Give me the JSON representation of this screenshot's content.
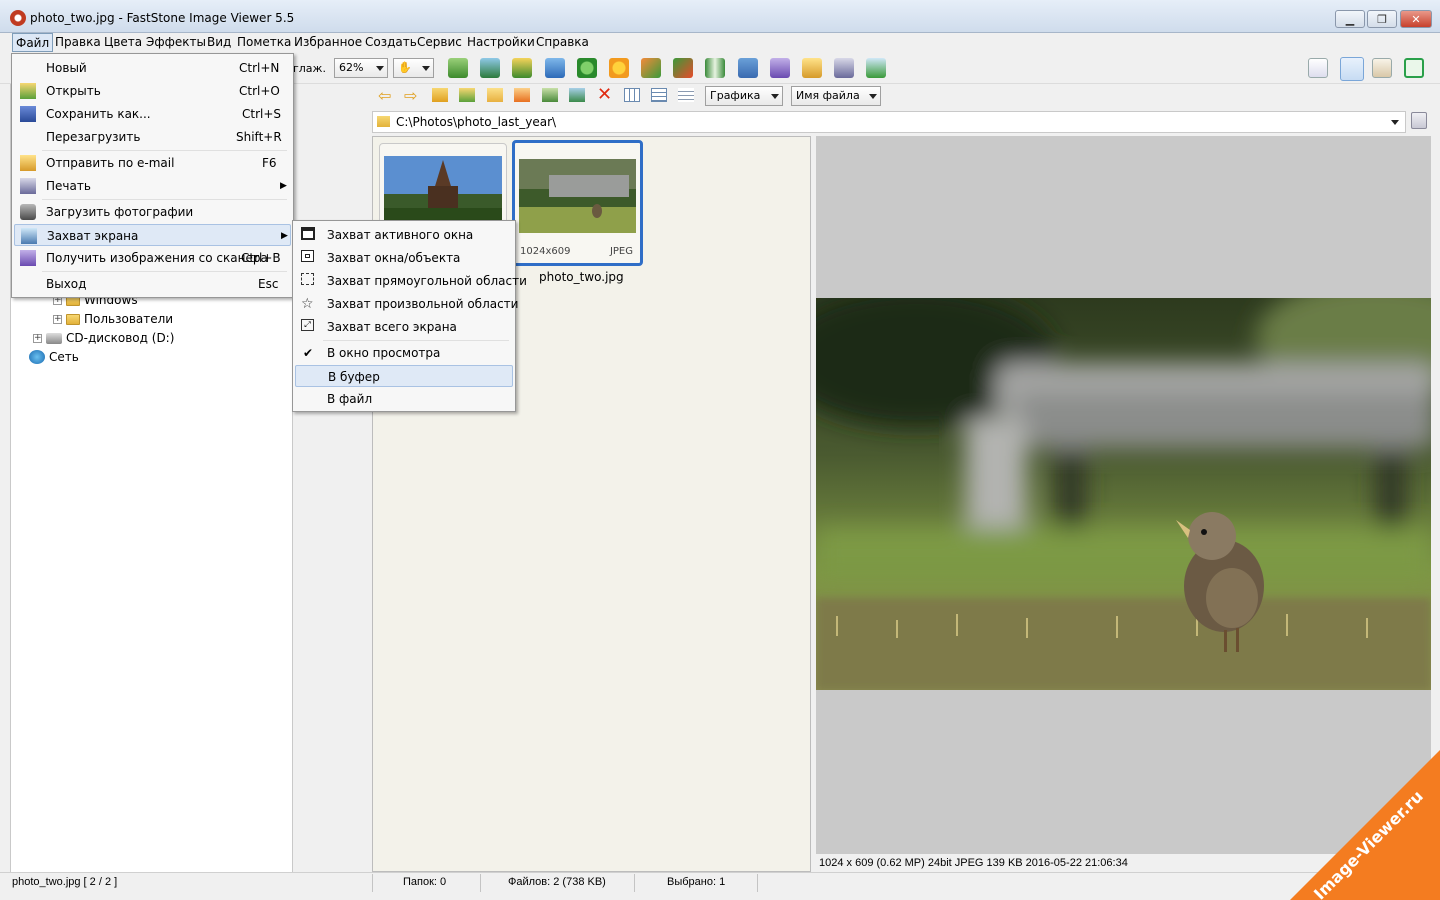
{
  "window": {
    "title": "photo_two.jpg  -  FastStone Image Viewer 5.5",
    "minimize_icon": "minimize-icon",
    "maximize_icon": "maximize-icon",
    "close_icon": "close-icon"
  },
  "menubar": [
    "Файл",
    "Правка",
    "Цвета",
    "Эффекты",
    "Вид",
    "Пометка",
    "Избранное",
    "Создать",
    "Сервис",
    "Настройки",
    "Справка"
  ],
  "toolbar": {
    "smooth_label": "глаж.",
    "zoom_value": "62%",
    "filter_value": "Графика",
    "sort_value": "Имя файла"
  },
  "path": "C:\\Photos\\photo_last_year\\",
  "tree": [
    {
      "label": "Windows"
    },
    {
      "label": "Пользователи"
    },
    {
      "label": "CD-дисковод (D:)"
    },
    {
      "label": "Сеть"
    }
  ],
  "file_menu": [
    {
      "label": "Новый",
      "shortcut": "Ctrl+N",
      "icon": ""
    },
    {
      "label": "Открыть",
      "shortcut": "Ctrl+O",
      "icon": "open-icon"
    },
    {
      "label": "Сохранить как...",
      "shortcut": "Ctrl+S",
      "icon": "save-icon"
    },
    {
      "label": "Перезагрузить",
      "shortcut": "Shift+R",
      "icon": ""
    },
    {
      "label": "Отправить по e-mail",
      "shortcut": "F6",
      "icon": "email-icon"
    },
    {
      "label": "Печать",
      "shortcut": "",
      "icon": "print-icon"
    },
    {
      "label": "Загрузить фотографии",
      "shortcut": "",
      "icon": "camera-icon"
    },
    {
      "label": "Захват экрана",
      "shortcut": "",
      "icon": "screen-capture-icon"
    },
    {
      "label": "Получить изображения со сканера",
      "shortcut": "Ctrl+B",
      "icon": "scanner-icon"
    },
    {
      "label": "Выход",
      "shortcut": "Esc",
      "icon": ""
    }
  ],
  "capture_submenu": [
    {
      "label": "Захват активного окна",
      "icon": "active-window-icon"
    },
    {
      "label": "Захват окна/объекта",
      "icon": "window-object-icon"
    },
    {
      "label": "Захват прямоугольной области",
      "icon": "rect-region-icon"
    },
    {
      "label": "Захват произвольной области",
      "icon": "freehand-region-icon"
    },
    {
      "label": "Захват всего экрана",
      "icon": "full-screen-icon"
    },
    {
      "label": "В окно просмотра",
      "icon": "check-icon",
      "checked": true
    },
    {
      "label": "В буфер",
      "icon": ""
    },
    {
      "label": "В файл",
      "icon": ""
    }
  ],
  "thumbnails": [
    {
      "name": "",
      "dimensions": "",
      "type": ""
    },
    {
      "name": "photo_two.jpg",
      "dimensions": "1024x609",
      "type": "JPEG"
    }
  ],
  "image_info": "1024 x 609 (0.62 MP)  24bit  JPEG   139 KB   2016-05-22 21:06:34",
  "status": {
    "file": "photo_two.jpg [ 2 / 2 ]",
    "folders": "Папок: 0",
    "files": "Файлов: 2 (738 KB)",
    "selected": "Выбрано: 1"
  },
  "watermark": "Image-Viewer.ru",
  "colors": {
    "accent": "#2f6ec7",
    "watermark": "#f47c20"
  }
}
